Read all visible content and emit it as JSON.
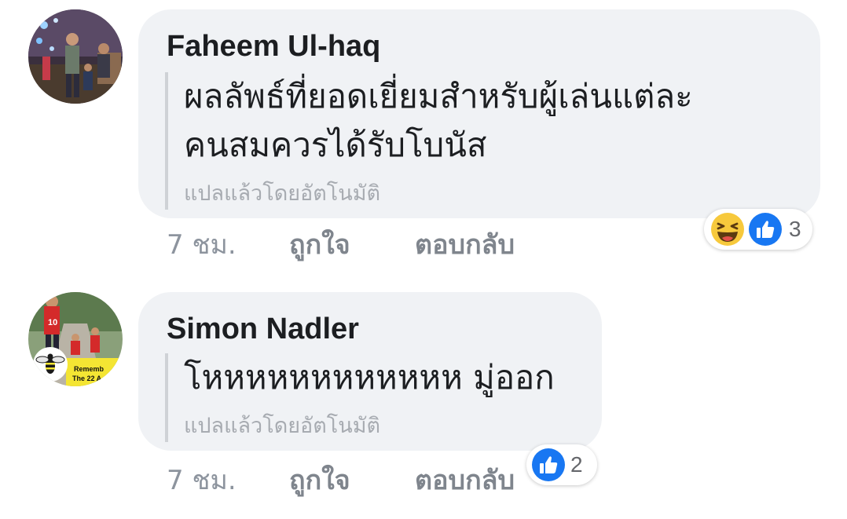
{
  "comments": [
    {
      "author": "Faheem Ul-haq",
      "text_lines": [
        "ผลลัพธ์ที่ยอดเยี่ยมสำหรับผู้เล่นแต่ละ",
        "คนสมควรได้รับโบนัส"
      ],
      "translated_note": "แปลแล้วโดยอัตโนมัติ",
      "time": "7 ชม.",
      "like_label": "ถูกใจ",
      "reply_label": "ตอบกลับ",
      "reactions": [
        "haha-icon",
        "like-icon"
      ],
      "reaction_count": "3"
    },
    {
      "author": "Simon Nadler",
      "text_lines": [
        "โหหหหหหหหหหหห มู่ออก"
      ],
      "translated_note": "แปลแล้วโดยอัตโนมัติ",
      "time": "7 ชม.",
      "like_label": "ถูกใจ",
      "reply_label": "ตอบกลับ",
      "reactions": [
        "like-icon"
      ],
      "reaction_count": "2",
      "avatar_text": [
        "Rememb",
        "The 22 A"
      ]
    }
  ],
  "colors": {
    "bubble": "#f0f2f5",
    "like_blue": "#1877f2",
    "haha_yellow": "#f7c93c",
    "muted_text": "#8d949e"
  }
}
